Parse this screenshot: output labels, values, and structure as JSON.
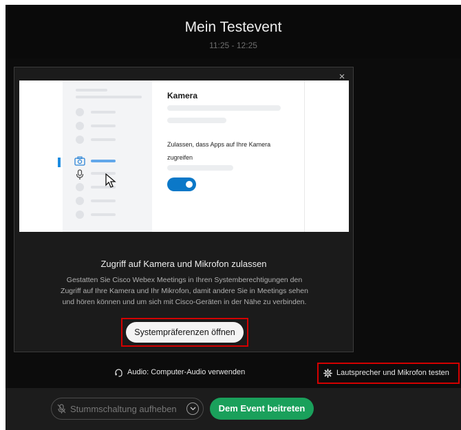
{
  "event": {
    "title": "Mein Testevent",
    "time": "11:25 - 12:25"
  },
  "dialog": {
    "close_label": "×",
    "illustration": {
      "card_title": "Kamera",
      "card_text": "Zulassen, dass Apps auf Ihre Kamera zugreifen",
      "toggle_on": true
    },
    "heading": "Zugriff auf Kamera und Mikrofon zulassen",
    "body": "Gestatten Sie Cisco Webex Meetings in Ihren Systemberechtigungen den Zugriff auf Ihre Kamera und Ihr Mikrofon, damit andere Sie in Meetings sehen und hören können und um sich mit Cisco-Geräten in der Nähe zu verbinden.",
    "open_prefs_label": "Systempräferenzen öffnen"
  },
  "audio": {
    "option_label": "Audio: Computer-Audio verwenden",
    "test_label": "Lautsprecher und Mikrofon testen",
    "icons": [
      "headset-icon",
      "gear-icon"
    ]
  },
  "controls": {
    "unmute_label": "Stummschaltung aufheben",
    "join_label": "Dem Event beitreten",
    "icons": [
      "mic-muted-icon",
      "chevron-down-icon"
    ]
  },
  "colors": {
    "join_green": "#1aa05b",
    "highlight_red": "#d40000",
    "toggle_blue": "#0b78c8",
    "active_blue": "#1b8be0"
  }
}
